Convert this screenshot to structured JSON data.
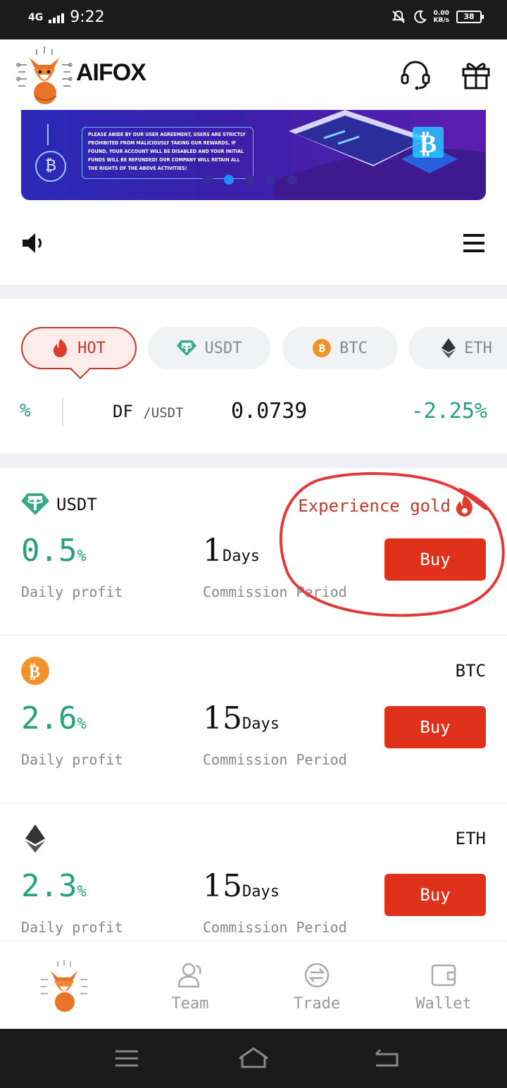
{
  "status_bar": {
    "network": "4G",
    "time": "9:22",
    "speed_value": "0.00",
    "speed_unit": "KB/s",
    "battery": "38"
  },
  "header": {
    "brand": "AIFOX",
    "icons": [
      "customer-service-icon",
      "gift-icon"
    ]
  },
  "banner": {
    "notice_text": "Please abide by our user agreement, users are strictly prohibited from maliciously taking our rewards, if found, your account will be disabled and your initial funds will be refunded! Our company will retain all the rights of the above activities!",
    "coin_symbol": "₿",
    "active_slide": 1,
    "slide_count": 5
  },
  "coin_tabs": [
    {
      "label": "HOT",
      "icon": "flame-icon",
      "active": true
    },
    {
      "label": "USDT",
      "icon": "tether-icon",
      "active": false
    },
    {
      "label": "BTC",
      "icon": "bitcoin-icon",
      "active": false
    },
    {
      "label": "ETH",
      "icon": "ethereum-icon",
      "active": false
    }
  ],
  "ticker": {
    "fragment": "%",
    "pair_base": "DF",
    "pair_quote": "/USDT",
    "price": "0.0739",
    "change": "-2.25%"
  },
  "products": [
    {
      "coin": "USDT",
      "tag": "Experience gold",
      "rate": "0.5",
      "rate_unit": "%",
      "days": "1",
      "days_unit": "Days",
      "profit_label": "Daily profit",
      "period_label": "Commission Period",
      "buy_label": "Buy"
    },
    {
      "coin": "BTC",
      "rate": "2.6",
      "rate_unit": "%",
      "days": "15",
      "days_unit": "Days",
      "profit_label": "Daily profit",
      "period_label": "Commission Period",
      "buy_label": "Buy"
    },
    {
      "coin": "ETH",
      "rate": "2.3",
      "rate_unit": "%",
      "days": "15",
      "days_unit": "Days",
      "profit_label": "Daily profit",
      "period_label": "Commission Period",
      "buy_label": "Buy"
    }
  ],
  "bottom_nav": [
    {
      "label": "",
      "icon": "home-logo-icon"
    },
    {
      "label": "Team",
      "icon": "team-icon"
    },
    {
      "label": "Trade",
      "icon": "trade-icon"
    },
    {
      "label": "Wallet",
      "icon": "wallet-icon"
    }
  ],
  "colors": {
    "accent_red": "#e0311b",
    "profit_green": "#27a17b",
    "status_bar": "#1b1b1b"
  }
}
